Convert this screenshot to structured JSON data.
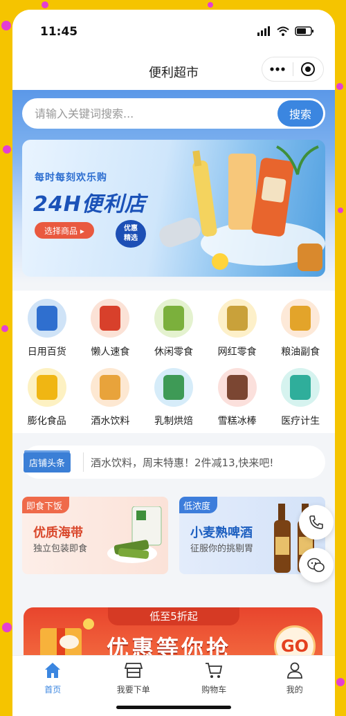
{
  "status_bar": {
    "time": "11:45"
  },
  "nav": {
    "title": "便利超市"
  },
  "search": {
    "placeholder": "请输入关键词搜索...",
    "button": "搜索"
  },
  "banner": {
    "subtitle": "每时每刻欢乐购",
    "title": "24H便利店",
    "button": "选择商品 ▸",
    "badge_line1": "优惠",
    "badge_line2": "精选"
  },
  "categories": [
    {
      "label": "日用百货",
      "color": "#cfe3f7",
      "item": "#2f6fcf"
    },
    {
      "label": "懒人速食",
      "color": "#fbe2d6",
      "item": "#d8402b"
    },
    {
      "label": "休闲零食",
      "color": "#e4f2cf",
      "item": "#7bb03c"
    },
    {
      "label": "网红零食",
      "color": "#fdf0c9",
      "item": "#c9a13a"
    },
    {
      "label": "粮油副食",
      "color": "#fde9d8",
      "item": "#e3a42a"
    },
    {
      "label": "膨化食品",
      "color": "#fdf1c2",
      "item": "#f0b613"
    },
    {
      "label": "酒水饮料",
      "color": "#fde8d2",
      "item": "#e8a33b"
    },
    {
      "label": "乳制烘焙",
      "color": "#d6ecf9",
      "item": "#3e9a56"
    },
    {
      "label": "雪糕冰棒",
      "color": "#fbe0dc",
      "item": "#7b4632"
    },
    {
      "label": "医疗计生",
      "color": "#d6f3ef",
      "item": "#2fae9b"
    }
  ],
  "notice": {
    "tag": "店铺头条",
    "text": "酒水饮料，周末特惠！2件减13,快来吧!"
  },
  "promos": [
    {
      "tag": "即食下饭",
      "title": "优质海带",
      "subtitle": "独立包装即食"
    },
    {
      "tag": "低浓度",
      "title": "小麦熟啤酒",
      "subtitle": "征服你的挑剔胃"
    }
  ],
  "sale": {
    "pill": "低至5折起",
    "title": "优惠等你抢",
    "go": "GO"
  },
  "tabs": [
    {
      "label": "首页",
      "icon": "home-icon",
      "active": true
    },
    {
      "label": "我要下单",
      "icon": "store-icon",
      "active": false
    },
    {
      "label": "购物车",
      "icon": "cart-icon",
      "active": false
    },
    {
      "label": "我的",
      "icon": "user-icon",
      "active": false
    }
  ],
  "colors": {
    "accent": "#3b86e0",
    "sale": "#e8452d"
  }
}
